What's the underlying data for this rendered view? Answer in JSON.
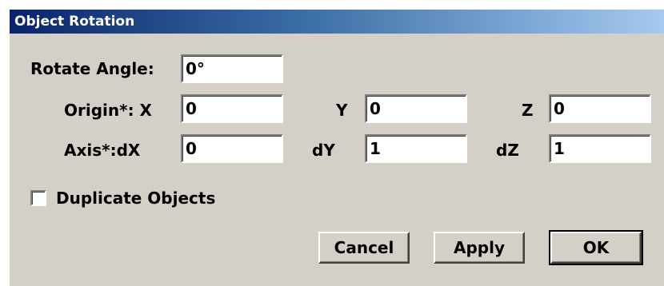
{
  "dialog": {
    "title": "Object Rotation"
  },
  "rotate": {
    "label": "Rotate Angle:",
    "value": "0°"
  },
  "origin": {
    "label": "Origin*: X",
    "x": "0",
    "y_label": "Y",
    "y": "0",
    "z_label": "Z",
    "z": "0"
  },
  "axis": {
    "label": "Axis*:dX",
    "dx": "0",
    "dy_label": "dY",
    "dy": "1",
    "dz_label": "dZ",
    "dz": "1"
  },
  "duplicate": {
    "label": "Duplicate Objects",
    "checked": false
  },
  "buttons": {
    "cancel": "Cancel",
    "apply": "Apply",
    "ok": "OK"
  },
  "colors": {
    "dialog_bg": "#d4d0c8",
    "title_start": "#0a246a",
    "title_end": "#a6caf0"
  }
}
